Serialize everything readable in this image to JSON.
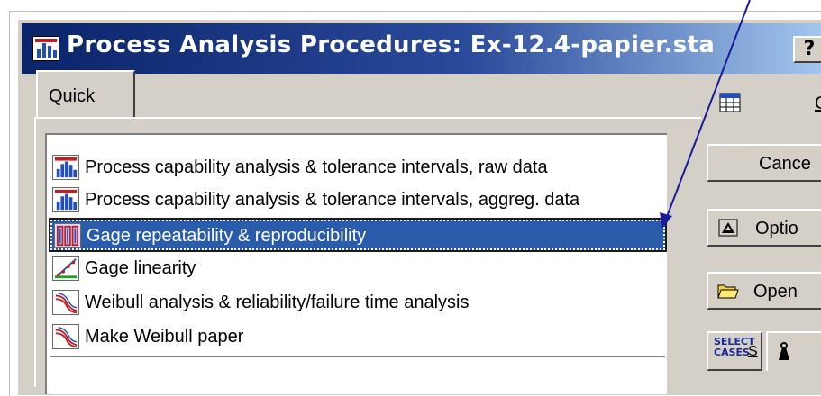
{
  "window": {
    "title": "Process Analysis Procedures: Ex-12.4-papier.sta",
    "help_label": "?"
  },
  "tabs": [
    {
      "label": "Quick"
    }
  ],
  "procedures": [
    {
      "label": "Process capability analysis & tolerance intervals, raw data",
      "icon": "histogram-icon",
      "selected": false
    },
    {
      "label": "Process capability analysis & tolerance intervals, aggreg. data",
      "icon": "histogram-icon",
      "selected": false
    },
    {
      "label": "Gage repeatability & reproducibility",
      "icon": "gage-rr-icon",
      "selected": true
    },
    {
      "label": "Gage linearity",
      "icon": "linearity-icon",
      "selected": false
    },
    {
      "label": "Weibull analysis & reliability/failure time analysis",
      "icon": "weibull-icon",
      "selected": false
    },
    {
      "label": "Make Weibull paper",
      "icon": "weibull-icon",
      "selected": false
    }
  ],
  "side_buttons": {
    "ok_label": "O",
    "cancel_label": "Cance",
    "options_label": "Optio",
    "open_label": "Open",
    "select_cases_line1": "SELECT",
    "select_cases_line2": "CASES",
    "select_cases_shortcut": "S"
  },
  "colors": {
    "title_gradient_start": "#0a246a",
    "title_gradient_end": "#a6caf0",
    "selection": "#2a5cab",
    "dialog_face": "#d4d0c8",
    "annotation_arrow": "#1a1a9a"
  }
}
